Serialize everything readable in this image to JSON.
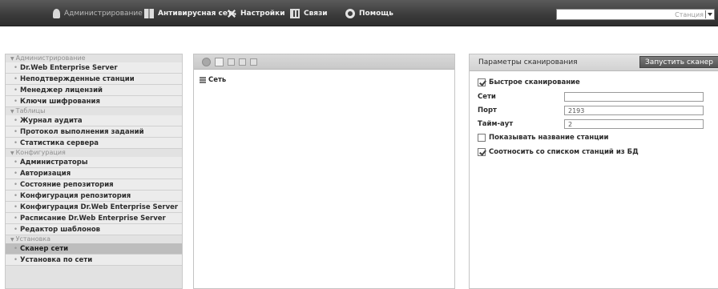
{
  "topbar": {
    "menu": [
      {
        "label": "Администрирование",
        "icon": "admin-icon"
      },
      {
        "label": "Антивирусная сеть",
        "icon": "network-icon"
      },
      {
        "label": "Настройки",
        "icon": "settings-icon"
      },
      {
        "label": "Связи",
        "icon": "links-icon"
      },
      {
        "label": "Помощь",
        "icon": "help-icon"
      }
    ],
    "search": {
      "value": "",
      "scope": "Станция"
    }
  },
  "sidebar": {
    "sections": [
      {
        "title": "Администрирование",
        "items": [
          "Dr.Web Enterprise Server",
          "Неподтвержденные станции",
          "Менеджер лицензий",
          "Ключи шифрования"
        ]
      },
      {
        "title": "Таблицы",
        "items": [
          "Журнал аудита",
          "Протокол выполнения заданий",
          "Статистика сервера"
        ]
      },
      {
        "title": "Конфигурация",
        "items": [
          "Администраторы",
          "Авторизация",
          "Состояние репозитория",
          "Конфигурация репозитория",
          "Конфигурация Dr.Web Enterprise Server",
          "Расписание Dr.Web Enterprise Server",
          "Редактор шаблонов"
        ]
      },
      {
        "title": "Установка",
        "items": [
          "Сканер сети",
          "Установка по сети"
        ]
      }
    ],
    "active": "Сканер сети"
  },
  "network_tree": {
    "root": "Сеть"
  },
  "scan_panel": {
    "title": "Параметры сканирования",
    "run_button": "Запустить сканер",
    "fast_scan": {
      "label": "Быстрое сканирование",
      "checked": true
    },
    "fields": {
      "networks": {
        "label": "Сети",
        "value": ""
      },
      "port": {
        "label": "Порт",
        "value": "2193"
      },
      "timeout": {
        "label": "Тайм-аут",
        "value": "2"
      }
    },
    "show_station_name": {
      "label": "Показывать название станции",
      "checked": false
    },
    "match_db": {
      "label": "Соотносить со списком станций из БД",
      "checked": true
    }
  }
}
